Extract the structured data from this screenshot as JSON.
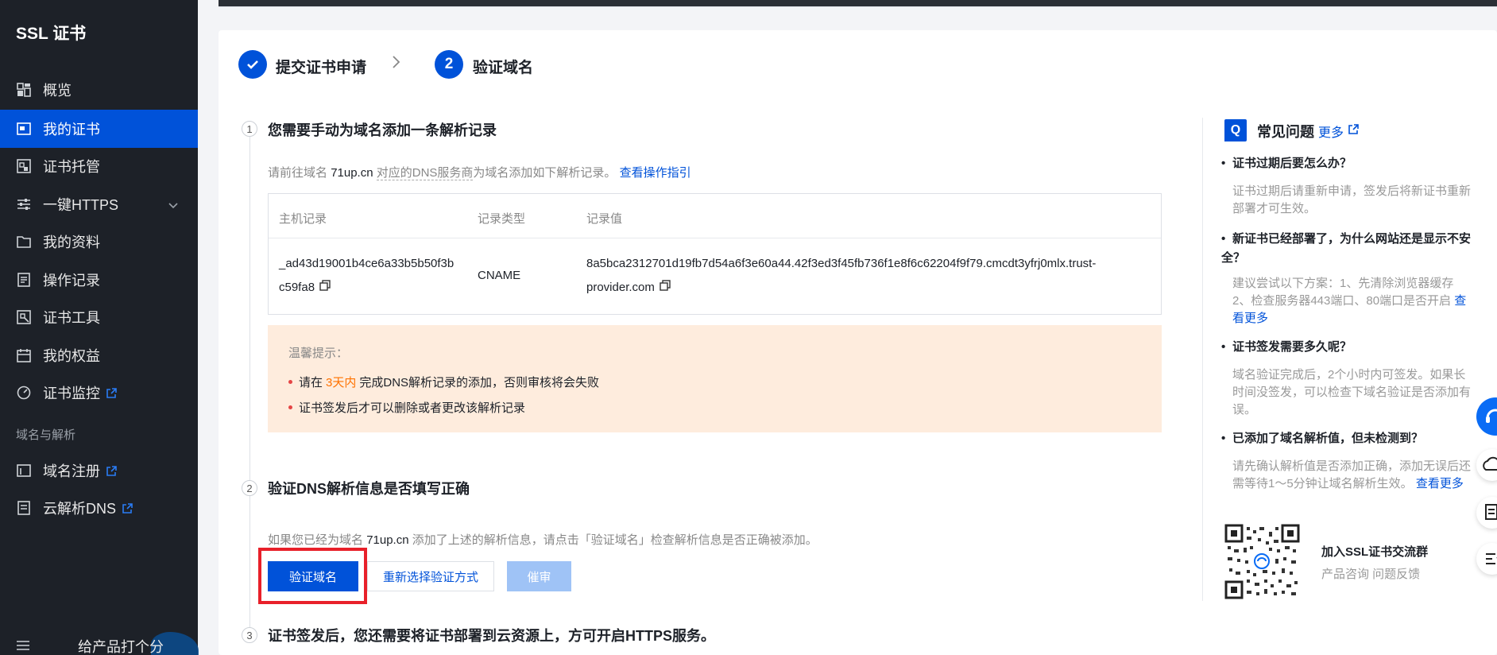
{
  "sidebar": {
    "title": "SSL 证书",
    "items": [
      {
        "label": "概览",
        "icon": "dashboard-icon"
      },
      {
        "label": "我的证书",
        "icon": "certificate-icon",
        "active": true
      },
      {
        "label": "证书托管",
        "icon": "hosting-icon"
      },
      {
        "label": "一键HTTPS",
        "icon": "sliders-icon",
        "expandable": true
      },
      {
        "label": "我的资料",
        "icon": "folder-icon"
      },
      {
        "label": "操作记录",
        "icon": "log-icon"
      },
      {
        "label": "证书工具",
        "icon": "tools-icon"
      },
      {
        "label": "我的权益",
        "icon": "calendar-icon"
      },
      {
        "label": "证书监控",
        "icon": "monitor-icon",
        "external": true
      }
    ],
    "section_label": "域名与解析",
    "section_items": [
      {
        "label": "域名注册",
        "icon": "domain-icon",
        "external": true
      },
      {
        "label": "云解析DNS",
        "icon": "dns-icon",
        "external": true
      }
    ],
    "feedback_label": "给产品打个分"
  },
  "steps": {
    "step1": "提交证书申请",
    "step2_num": "2",
    "step2": "验证域名"
  },
  "section1": {
    "num": "1",
    "title": "您需要手动为域名添加一条解析记录",
    "desc_prefix": "请前往域名",
    "domain": "71up.cn",
    "desc_dotted": "对应的DNS服务商",
    "desc_suffix": "为域名添加如下解析记录。",
    "link": "查看操作指引",
    "table": {
      "headers": [
        "主机记录",
        "记录类型",
        "记录值"
      ],
      "row": {
        "host_line1": "_ad43d19001b4ce6a33b5b50f3b",
        "host_line2": "c59fa8",
        "type": "CNAME",
        "value_line1": "8a5bca2312701d19fb7d54a6f3e60a44.42f3ed3f45fb736f1e8f6c62204f9f79.cmcdt3yfrj0mlx.trust-",
        "value_line2": "provider.com"
      }
    },
    "tip": {
      "title": "温馨提示：",
      "item1_prefix": "请在",
      "item1_highlight": "3天内",
      "item1_suffix": "完成DNS解析记录的添加，否则审核将会失败",
      "item2": "证书签发后才可以删除或者更改该解析记录"
    }
  },
  "section2": {
    "num": "2",
    "title": "验证DNS解析信息是否填写正确",
    "desc_prefix": "如果您已经为域名",
    "domain": "71up.cn",
    "desc_suffix": "添加了上述的解析信息，请点击「验证域名」检查解析信息是否正确被添加。",
    "btn_verify": "验证域名",
    "btn_reselect": "重新选择验证方式",
    "btn_urge": "催审"
  },
  "section3": {
    "num": "3",
    "title": "证书签发后，您还需要将证书部署到云资源上，方可开启HTTPS服务。"
  },
  "faq": {
    "icon_letter": "Q",
    "title": "常见问题",
    "more": "更多",
    "items": [
      {
        "q": "证书过期后要怎么办？",
        "a": "证书过期后请重新申请，签发后将新证书重新部署才可生效。",
        "link": ""
      },
      {
        "q": "新证书已经部署了，为什么网站还是显示不安全？",
        "a": "建议尝试以下方案：1、先清除浏览器缓存 2、检查服务器443端口、80端口是否开启",
        "link": "查看更多"
      },
      {
        "q": "证书签发需要多久呢？",
        "a": "域名验证完成后，2个小时内可签发。如果长时间没签发，可以检查下域名验证是否添加有误。",
        "link": ""
      },
      {
        "q": "已添加了域名解析值，但未检测到？",
        "a": "请先确认解析值是否添加正确，添加无误后还需等待1～5分钟让域名解析生效。",
        "link": "查看更多"
      }
    ],
    "group_title": "加入SSL证书交流群",
    "group_sub": "产品咨询 问题反馈"
  }
}
